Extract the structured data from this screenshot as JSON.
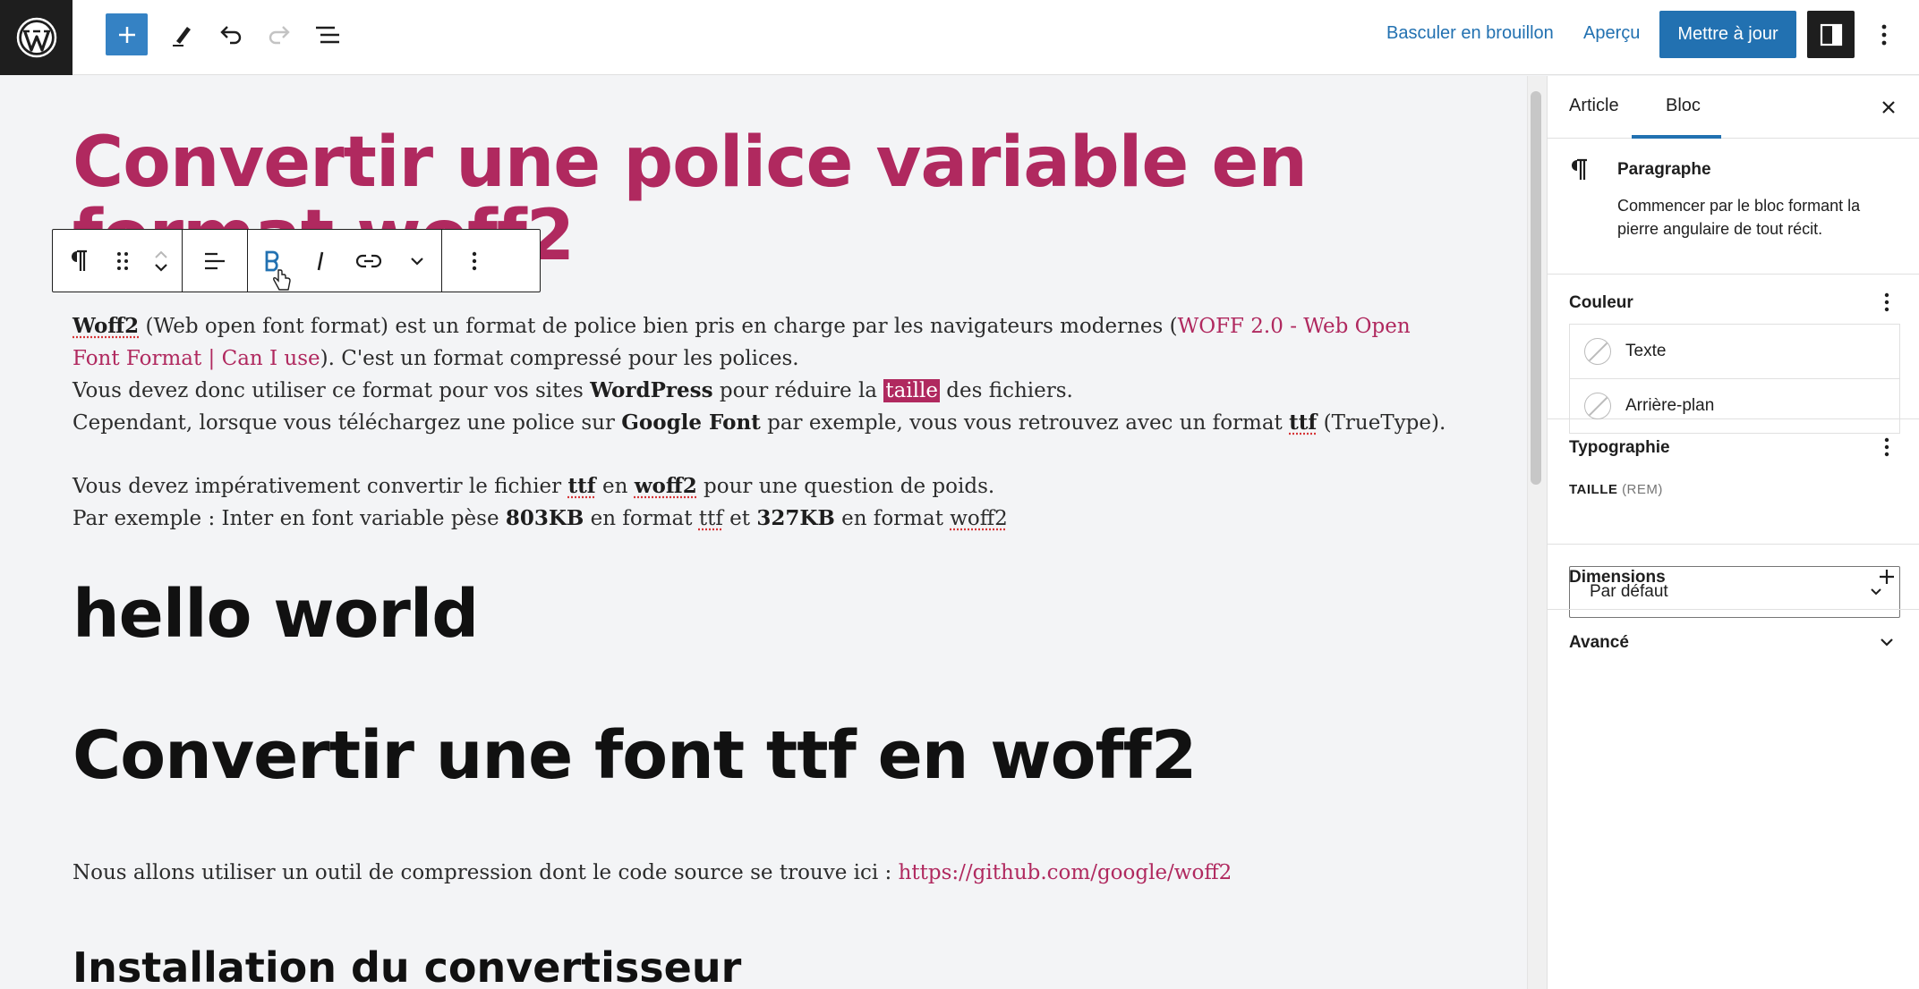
{
  "topbar": {
    "switch_draft": "Basculer en brouillon",
    "preview": "Aperçu",
    "update": "Mettre à jour"
  },
  "post": {
    "title": "Convertir une police variable en format woff2",
    "p1": {
      "s1": "Woff2",
      "s2": " (Web open font format) est un format de police bien pris en charge par les navigateurs modernes (",
      "link": "WOFF 2.0 - Web Open Font Format | Can I use",
      "s3": "). C'est un format compressé pour les polices."
    },
    "p2": {
      "s1": "Vous devez donc utiliser ce format pour vos sites ",
      "b1": "WordPress",
      "s2": " pour réduire la ",
      "hl": "taille",
      "s3": " des fichiers."
    },
    "p3": {
      "s1": "Cependant, lorsque vous téléchargez une police sur ",
      "b1": "Google Font",
      "s2": " par exemple, vous vous retrouvez avec un format ",
      "b2": "ttf",
      "s3": " (TrueType)."
    },
    "p4": {
      "s1": "Vous devez impérativement convertir le fichier ",
      "b1": "ttf",
      "s2": " en ",
      "b2": "woff2",
      "s3": " pour une question de poids."
    },
    "p5": {
      "s1": "Par exemple : Inter en font variable pèse ",
      "b1": "803KB",
      "s2": " en format ",
      "u1": "ttf",
      "s3": " et ",
      "b2": "327KB",
      "s4": " en format ",
      "u2": "woff2"
    },
    "heading1": "hello world",
    "heading2": "Convertir une font ttf en woff2",
    "p6": {
      "s1": "Nous allons utiliser un outil de compression dont le code source se trouve ici : ",
      "link": "https://github.com/google/woff2"
    },
    "heading3": "Installation du convertisseur"
  },
  "sidebar": {
    "tabs": [
      "Article",
      "Bloc"
    ],
    "active_tab": "Bloc",
    "block": {
      "name": "Paragraphe",
      "description": "Commencer par le bloc formant la pierre angulaire de tout récit."
    },
    "color": {
      "title": "Couleur",
      "items": [
        "Texte",
        "Arrière-plan"
      ]
    },
    "typography": {
      "title": "Typographie",
      "size_label": "TAILLE",
      "size_unit": "(REM)",
      "size_value": "Par défaut"
    },
    "dimensions": "Dimensions",
    "advanced": "Avancé"
  },
  "colors": {
    "accent": "#b0295f",
    "primary": "#2271b1",
    "dark": "#1e1e1e"
  },
  "icons": [
    "wordpress-logo-icon",
    "plus-icon",
    "pencil-icon",
    "undo-icon",
    "redo-icon",
    "list-view-icon",
    "sidebar-toggle-icon",
    "more-vertical-icon",
    "paragraph-icon",
    "drag-handle-icon",
    "move-up-icon",
    "move-down-icon",
    "align-icon",
    "bold-icon",
    "italic-icon",
    "link-icon",
    "chevron-down-icon",
    "close-icon",
    "plus-icon",
    "cursor-hand-icon"
  ]
}
